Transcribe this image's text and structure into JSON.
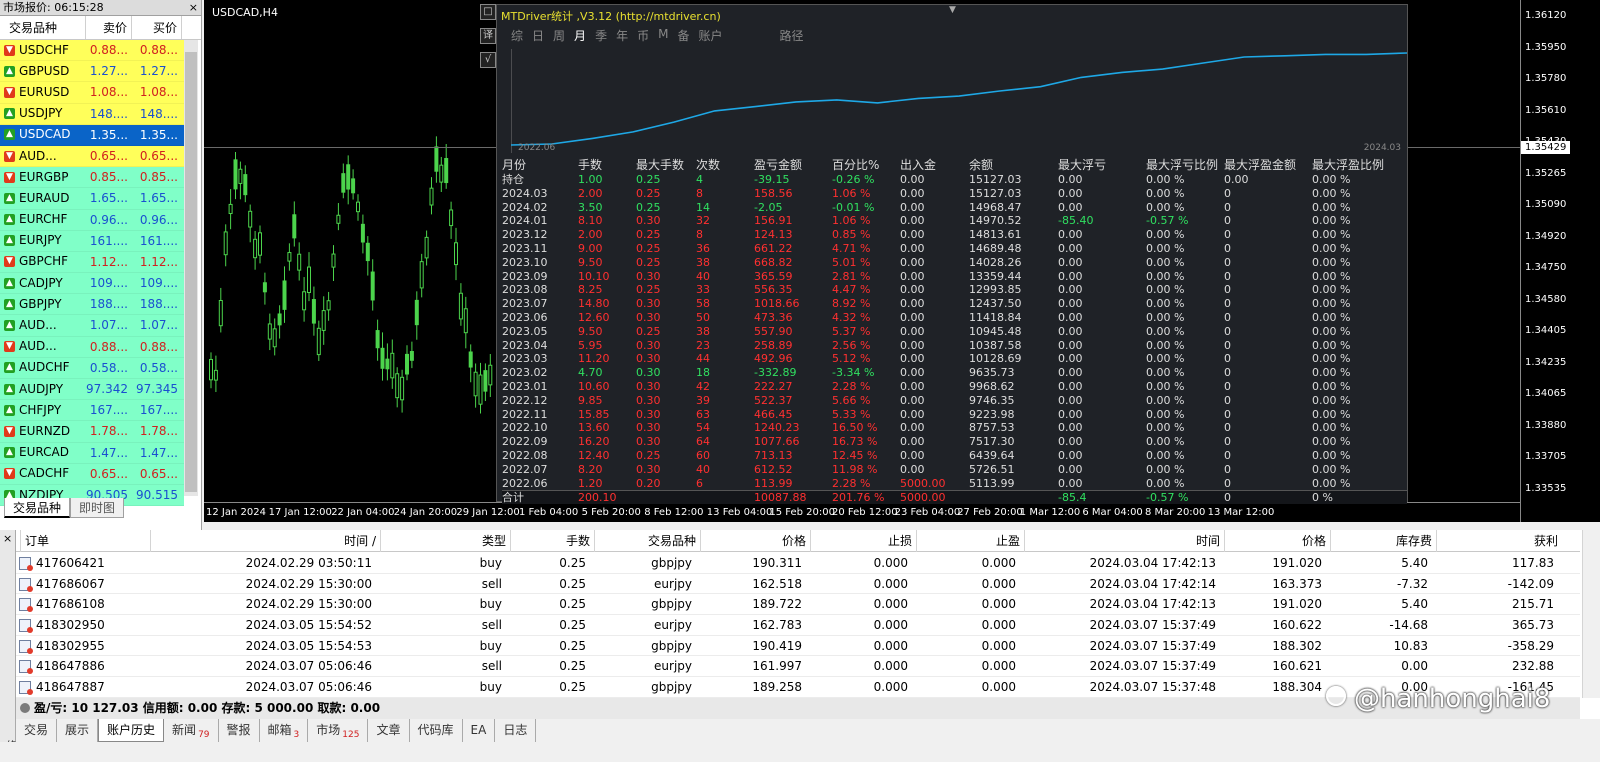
{
  "market_watch": {
    "title": "市场报价: 06:15:28",
    "close": "×",
    "headers": [
      "交易品种",
      "卖价",
      "买价"
    ],
    "rows": [
      {
        "symbol": "USDCHF",
        "bid": "0.88...",
        "ask": "0.88...",
        "dir": "down",
        "bg": "#ffff5a",
        "color": "#d02020"
      },
      {
        "symbol": "GBPUSD",
        "bid": "1.27...",
        "ask": "1.27...",
        "dir": "up",
        "bg": "#ffff5a",
        "color": "#1a4fd0"
      },
      {
        "symbol": "EURUSD",
        "bid": "1.08...",
        "ask": "1.08...",
        "dir": "down",
        "bg": "#ffff5a",
        "color": "#d02020"
      },
      {
        "symbol": "USDJPY",
        "bid": "148....",
        "ask": "148....",
        "dir": "up",
        "bg": "#ffff5a",
        "color": "#1a4fd0"
      },
      {
        "symbol": "USDCAD",
        "bid": "1.35...",
        "ask": "1.35...",
        "dir": "up",
        "bg": "#0a64c8",
        "color": "#ffffff",
        "selected": true
      },
      {
        "symbol": "AUD...",
        "bid": "0.65...",
        "ask": "0.65...",
        "dir": "down",
        "bg": "#ffff5a",
        "color": "#d02020"
      },
      {
        "symbol": "EURGBP",
        "bid": "0.85...",
        "ask": "0.85...",
        "dir": "down",
        "bg": "#80ffc8",
        "color": "#d02020"
      },
      {
        "symbol": "EURAUD",
        "bid": "1.65...",
        "ask": "1.65...",
        "dir": "up",
        "bg": "#80ffc8",
        "color": "#1a4fd0"
      },
      {
        "symbol": "EURCHF",
        "bid": "0.96...",
        "ask": "0.96...",
        "dir": "up",
        "bg": "#80ffc8",
        "color": "#1a4fd0"
      },
      {
        "symbol": "EURJPY",
        "bid": "161....",
        "ask": "161....",
        "dir": "up",
        "bg": "#80ffc8",
        "color": "#1a4fd0"
      },
      {
        "symbol": "GBPCHF",
        "bid": "1.12...",
        "ask": "1.12...",
        "dir": "down",
        "bg": "#80ffc8",
        "color": "#d02020"
      },
      {
        "symbol": "CADJPY",
        "bid": "109....",
        "ask": "109....",
        "dir": "up",
        "bg": "#80ffc8",
        "color": "#1a4fd0"
      },
      {
        "symbol": "GBPJPY",
        "bid": "188....",
        "ask": "188....",
        "dir": "up",
        "bg": "#80ffc8",
        "color": "#1a4fd0"
      },
      {
        "symbol": "AUD...",
        "bid": "1.07...",
        "ask": "1.07...",
        "dir": "up",
        "bg": "#80ffc8",
        "color": "#1a4fd0"
      },
      {
        "symbol": "AUD...",
        "bid": "0.88...",
        "ask": "0.88...",
        "dir": "down",
        "bg": "#80ffc8",
        "color": "#d02020"
      },
      {
        "symbol": "AUDCHF",
        "bid": "0.58...",
        "ask": "0.58...",
        "dir": "up",
        "bg": "#80ffc8",
        "color": "#1a4fd0"
      },
      {
        "symbol": "AUDJPY",
        "bid": "97.342",
        "ask": "97.345",
        "dir": "up",
        "bg": "#80ffc8",
        "color": "#1a4fd0"
      },
      {
        "symbol": "CHFJPY",
        "bid": "167....",
        "ask": "167....",
        "dir": "up",
        "bg": "#80ffc8",
        "color": "#1a4fd0"
      },
      {
        "symbol": "EURNZD",
        "bid": "1.78...",
        "ask": "1.78...",
        "dir": "down",
        "bg": "#80ffc8",
        "color": "#d02020"
      },
      {
        "symbol": "EURCAD",
        "bid": "1.47...",
        "ask": "1.47...",
        "dir": "up",
        "bg": "#80ffc8",
        "color": "#1a4fd0"
      },
      {
        "symbol": "CADCHF",
        "bid": "0.65...",
        "ask": "0.65...",
        "dir": "down",
        "bg": "#80ffc8",
        "color": "#d02020"
      },
      {
        "symbol": "NZDJPY",
        "bid": "90.505",
        "ask": "90.515",
        "dir": "up",
        "bg": "#80ffc8",
        "color": "#1a4fd0"
      }
    ],
    "tabs": [
      "交易品种",
      "即时图"
    ]
  },
  "chart": {
    "symbol_label": "USDCAD,H4",
    "price_labels": [
      "1.36120",
      "1.35950",
      "1.35780",
      "1.35610",
      "1.35430",
      "1.35265",
      "1.35090",
      "1.34920",
      "1.34750",
      "1.34580",
      "1.34405",
      "1.34235",
      "1.34065",
      "1.33880",
      "1.33705",
      "1.33535"
    ],
    "current_price": "1.35429",
    "time_labels": [
      "12 Jan 2024",
      "17 Jan 12:00",
      "22 Jan 04:00",
      "24 Jan 20:00",
      "29 Jan 12:00",
      "1 Feb 04:00",
      "5 Feb 20:00",
      "8 Feb 12:00",
      "13 Feb 04:00",
      "15 Feb 20:00",
      "20 Feb 12:00",
      "23 Feb 04:00",
      "27 Feb 20:00",
      "1 Mar 12:00",
      "6 Mar 04:00",
      "8 Mar 20:00",
      "13 Mar 12:00"
    ],
    "candle_color": "#4cd44c",
    "side_icons": [
      "square-icon",
      "translate-icon",
      "check-icon"
    ]
  },
  "panel": {
    "title": "MTDriver统计 ,V3.12 (http://mtdriver.cn)",
    "tabs": [
      "综",
      "日",
      "周",
      "月",
      "季",
      "年",
      "币",
      "M",
      "备",
      "账户",
      "路径"
    ],
    "active_tab": "月",
    "date_start": "2022.06",
    "date_end": "2024.03",
    "line_color": "#1ea8e6",
    "headers": [
      "月份",
      "手数",
      "最大手数",
      "次数",
      "盈亏金额",
      "百分比%",
      "出入金",
      "余额",
      "最大浮亏",
      "最大浮亏比例",
      "最大浮盈金额",
      "最大浮盈比例"
    ],
    "rows": [
      {
        "c": [
          "持仓",
          "1.00",
          "0.25",
          "4",
          "-39.15",
          "-0.26 %",
          "0.00",
          "15127.03",
          "0.00",
          "0.00 %",
          "0.00",
          "0.00 %"
        ],
        "kind": "hold"
      },
      {
        "c": [
          "2024.03",
          "2.00",
          "0.25",
          "8",
          "158.56",
          "1.06 %",
          "0.00",
          "15127.03",
          "0.00",
          "0.00 %",
          "0",
          "0.00 %"
        ],
        "kind": "neg"
      },
      {
        "c": [
          "2024.02",
          "3.50",
          "0.25",
          "14",
          "-2.05",
          "-0.01 %",
          "0.00",
          "14968.47",
          "0.00",
          "0.00 %",
          "0",
          "0.00 %"
        ],
        "kind": "pos"
      },
      {
        "c": [
          "2024.01",
          "8.10",
          "0.30",
          "32",
          "156.91",
          "1.06 %",
          "0.00",
          "14970.52",
          "-85.40",
          "-0.57 %",
          "0",
          "0.00 %"
        ],
        "kind": "neg",
        "float_neg": true
      },
      {
        "c": [
          "2023.12",
          "2.00",
          "0.25",
          "8",
          "124.13",
          "0.85 %",
          "0.00",
          "14813.61",
          "0.00",
          "0.00 %",
          "0",
          "0.00 %"
        ],
        "kind": "neg"
      },
      {
        "c": [
          "2023.11",
          "9.00",
          "0.25",
          "36",
          "661.22",
          "4.71 %",
          "0.00",
          "14689.48",
          "0.00",
          "0.00 %",
          "0",
          "0.00 %"
        ],
        "kind": "neg"
      },
      {
        "c": [
          "2023.10",
          "9.50",
          "0.25",
          "38",
          "668.82",
          "5.01 %",
          "0.00",
          "14028.26",
          "0.00",
          "0.00 %",
          "0",
          "0.00 %"
        ],
        "kind": "neg"
      },
      {
        "c": [
          "2023.09",
          "10.10",
          "0.30",
          "40",
          "365.59",
          "2.81 %",
          "0.00",
          "13359.44",
          "0.00",
          "0.00 %",
          "0",
          "0.00 %"
        ],
        "kind": "neg"
      },
      {
        "c": [
          "2023.08",
          "8.25",
          "0.25",
          "33",
          "556.35",
          "4.47 %",
          "0.00",
          "12993.85",
          "0.00",
          "0.00 %",
          "0",
          "0.00 %"
        ],
        "kind": "neg"
      },
      {
        "c": [
          "2023.07",
          "14.80",
          "0.30",
          "58",
          "1018.66",
          "8.92 %",
          "0.00",
          "12437.50",
          "0.00",
          "0.00 %",
          "0",
          "0.00 %"
        ],
        "kind": "neg"
      },
      {
        "c": [
          "2023.06",
          "12.60",
          "0.30",
          "50",
          "473.36",
          "4.32 %",
          "0.00",
          "11418.84",
          "0.00",
          "0.00 %",
          "0",
          "0.00 %"
        ],
        "kind": "neg"
      },
      {
        "c": [
          "2023.05",
          "9.50",
          "0.25",
          "38",
          "557.90",
          "5.37 %",
          "0.00",
          "10945.48",
          "0.00",
          "0.00 %",
          "0",
          "0.00 %"
        ],
        "kind": "neg"
      },
      {
        "c": [
          "2023.04",
          "5.95",
          "0.30",
          "23",
          "258.89",
          "2.56 %",
          "0.00",
          "10387.58",
          "0.00",
          "0.00 %",
          "0",
          "0.00 %"
        ],
        "kind": "neg"
      },
      {
        "c": [
          "2023.03",
          "11.20",
          "0.30",
          "44",
          "492.96",
          "5.12 %",
          "0.00",
          "10128.69",
          "0.00",
          "0.00 %",
          "0",
          "0.00 %"
        ],
        "kind": "neg"
      },
      {
        "c": [
          "2023.02",
          "4.70",
          "0.30",
          "18",
          "-332.89",
          "-3.34 %",
          "0.00",
          "9635.73",
          "0.00",
          "0.00 %",
          "0",
          "0.00 %"
        ],
        "kind": "pos"
      },
      {
        "c": [
          "2023.01",
          "10.60",
          "0.30",
          "42",
          "222.27",
          "2.28 %",
          "0.00",
          "9968.62",
          "0.00",
          "0.00 %",
          "0",
          "0.00 %"
        ],
        "kind": "neg"
      },
      {
        "c": [
          "2022.12",
          "9.85",
          "0.30",
          "39",
          "522.37",
          "5.66 %",
          "0.00",
          "9746.35",
          "0.00",
          "0.00 %",
          "0",
          "0.00 %"
        ],
        "kind": "neg"
      },
      {
        "c": [
          "2022.11",
          "15.85",
          "0.30",
          "63",
          "466.45",
          "5.33 %",
          "0.00",
          "9223.98",
          "0.00",
          "0.00 %",
          "0",
          "0.00 %"
        ],
        "kind": "neg"
      },
      {
        "c": [
          "2022.10",
          "13.60",
          "0.30",
          "54",
          "1240.23",
          "16.50 %",
          "0.00",
          "8757.53",
          "0.00",
          "0.00 %",
          "0",
          "0.00 %"
        ],
        "kind": "neg"
      },
      {
        "c": [
          "2022.09",
          "16.20",
          "0.30",
          "64",
          "1077.66",
          "16.73 %",
          "0.00",
          "7517.30",
          "0.00",
          "0.00 %",
          "0",
          "0.00 %"
        ],
        "kind": "neg"
      },
      {
        "c": [
          "2022.08",
          "12.40",
          "0.25",
          "60",
          "713.13",
          "12.45 %",
          "0.00",
          "6439.64",
          "0.00",
          "0.00 %",
          "0",
          "0.00 %"
        ],
        "kind": "neg"
      },
      {
        "c": [
          "2022.07",
          "8.20",
          "0.30",
          "40",
          "612.52",
          "11.98 %",
          "0.00",
          "5726.51",
          "0.00",
          "0.00 %",
          "0",
          "0.00 %"
        ],
        "kind": "neg"
      },
      {
        "c": [
          "2022.06",
          "1.20",
          "0.20",
          "6",
          "113.99",
          "2.28 %",
          "5000.00",
          "5113.99",
          "0.00",
          "0.00 %",
          "0",
          "0.00 %"
        ],
        "kind": "neg",
        "dep_neg": true
      }
    ],
    "total": {
      "c": [
        "合计",
        "200.10",
        "",
        "",
        "10087.88",
        "201.76 %",
        "5000.00",
        "",
        "-85.4",
        "-0.57 %",
        "0",
        "0 %"
      ]
    }
  },
  "terminal": {
    "close": "×",
    "vertical_label": "终端",
    "headers": [
      "订单",
      "时间",
      "类型",
      "手数",
      "交易品种",
      "价格",
      "止损",
      "止盈",
      "时间",
      "价格",
      "库存费",
      "获利"
    ],
    "rows": [
      [
        "417606421",
        "2024.02.29 03:50:11",
        "buy",
        "0.25",
        "gbpjpy",
        "190.311",
        "0.000",
        "0.000",
        "2024.03.04 17:42:13",
        "191.020",
        "5.40",
        "117.83"
      ],
      [
        "417686067",
        "2024.02.29 15:30:00",
        "sell",
        "0.25",
        "eurjpy",
        "162.518",
        "0.000",
        "0.000",
        "2024.03.04 17:42:14",
        "163.373",
        "-7.32",
        "-142.09"
      ],
      [
        "417686108",
        "2024.02.29 15:30:00",
        "buy",
        "0.25",
        "gbpjpy",
        "189.722",
        "0.000",
        "0.000",
        "2024.03.04 17:42:13",
        "191.020",
        "5.40",
        "215.71"
      ],
      [
        "418302950",
        "2024.03.05 15:54:52",
        "sell",
        "0.25",
        "eurjpy",
        "162.783",
        "0.000",
        "0.000",
        "2024.03.07 15:37:49",
        "160.622",
        "-14.68",
        "365.73"
      ],
      [
        "418302955",
        "2024.03.05 15:54:53",
        "buy",
        "0.25",
        "gbpjpy",
        "190.419",
        "0.000",
        "0.000",
        "2024.03.07 15:37:49",
        "188.302",
        "10.83",
        "-358.29"
      ],
      [
        "418647886",
        "2024.03.07 05:06:46",
        "sell",
        "0.25",
        "eurjpy",
        "161.997",
        "0.000",
        "0.000",
        "2024.03.07 15:37:49",
        "160.621",
        "0.00",
        "232.88"
      ],
      [
        "418647887",
        "2024.03.07 05:06:46",
        "buy",
        "0.25",
        "gbpjpy",
        "189.258",
        "0.000",
        "0.000",
        "2024.03.07 15:37:48",
        "188.304",
        "0.00",
        "-161.45"
      ]
    ],
    "summary": "盈/亏: 10 127.03  信用额: 0.00  存款: 5 000.00  取款: 0.00",
    "tabs": [
      {
        "label": "交易"
      },
      {
        "label": "展示"
      },
      {
        "label": "账户历史",
        "active": true
      },
      {
        "label": "新闻",
        "badge": "79"
      },
      {
        "label": "警报"
      },
      {
        "label": "邮箱",
        "badge": "3"
      },
      {
        "label": "市场",
        "badge": "125"
      },
      {
        "label": "文章"
      },
      {
        "label": "代码库"
      },
      {
        "label": "EA"
      },
      {
        "label": "日志"
      }
    ]
  },
  "watermark": "@hanhonghai8"
}
